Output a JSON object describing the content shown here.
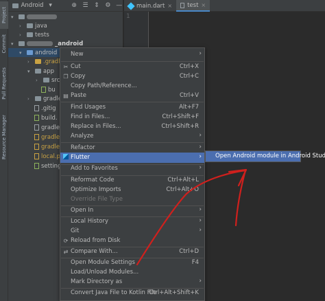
{
  "left_strip": {
    "tabs": [
      "Project",
      "Commit",
      "Pull Requests",
      "Resource Manager"
    ]
  },
  "project_panel": {
    "title": "Android",
    "tree": [
      {
        "label": "java",
        "indent": 2,
        "icon": "folder"
      },
      {
        "label": "tests",
        "indent": 2,
        "icon": "folder"
      },
      {
        "label": "_android",
        "indent": 1,
        "icon": "folder",
        "bold": true
      },
      {
        "label": "android",
        "indent": 2,
        "icon": "folder-blue",
        "selected": true
      },
      {
        "label": ".gradle",
        "indent": 3,
        "icon": "folder-orange"
      },
      {
        "label": "app",
        "indent": 3,
        "icon": "folder"
      },
      {
        "label": "src",
        "indent": 4,
        "icon": "folder"
      },
      {
        "label": "bu",
        "indent": 4,
        "icon": "folder"
      },
      {
        "label": "gradle",
        "indent": 3,
        "icon": "folder"
      },
      {
        "label": ".gitig",
        "indent": 3,
        "icon": "file"
      },
      {
        "label": "build.",
        "indent": 3,
        "icon": "file-green"
      },
      {
        "label": "gradle",
        "indent": 3,
        "icon": "file"
      },
      {
        "label": "gradle",
        "indent": 3,
        "icon": "file-orange"
      },
      {
        "label": "gradle",
        "indent": 3,
        "icon": "file-orange"
      },
      {
        "label": "local.p",
        "indent": 3,
        "icon": "file-orange"
      },
      {
        "label": "setting",
        "indent": 3,
        "icon": "file"
      }
    ]
  },
  "editor": {
    "tabs": [
      {
        "label": "main.dart",
        "active": false
      },
      {
        "label": "test",
        "active": true
      }
    ],
    "line_number": "1"
  },
  "context_menu": {
    "items": [
      {
        "label": "New",
        "shortcut": "",
        "submenu": true
      },
      {
        "sep": true
      },
      {
        "label": "Cut",
        "shortcut": "Ctrl+X",
        "icon": "cut-icon"
      },
      {
        "label": "Copy",
        "shortcut": "Ctrl+C",
        "icon": "copy-icon"
      },
      {
        "label": "Copy Path/Reference...",
        "shortcut": ""
      },
      {
        "label": "Paste",
        "shortcut": "Ctrl+V",
        "icon": "paste-icon"
      },
      {
        "sep": true
      },
      {
        "label": "Find Usages",
        "shortcut": "Alt+F7"
      },
      {
        "label": "Find in Files...",
        "shortcut": "Ctrl+Shift+F"
      },
      {
        "label": "Replace in Files...",
        "shortcut": "Ctrl+Shift+R"
      },
      {
        "label": "Analyze",
        "shortcut": "",
        "submenu": true
      },
      {
        "sep": true
      },
      {
        "label": "Refactor",
        "shortcut": "",
        "submenu": true
      },
      {
        "sep": true
      },
      {
        "label": "Flutter",
        "shortcut": "",
        "submenu": true,
        "highlighted": true,
        "icon": "flutter-icon"
      },
      {
        "sep": true
      },
      {
        "label": "Add to Favorites",
        "shortcut": "",
        "submenu": true
      },
      {
        "sep": true
      },
      {
        "label": "Reformat Code",
        "shortcut": "Ctrl+Alt+L"
      },
      {
        "label": "Optimize Imports",
        "shortcut": "Ctrl+Alt+O"
      },
      {
        "label": "Override File Type",
        "shortcut": "",
        "disabled": true
      },
      {
        "sep": true
      },
      {
        "label": "Open In",
        "shortcut": "",
        "submenu": true
      },
      {
        "sep": true
      },
      {
        "label": "Local History",
        "shortcut": "",
        "submenu": true
      },
      {
        "label": "Git",
        "shortcut": "",
        "submenu": true
      },
      {
        "label": "Reload from Disk",
        "shortcut": "",
        "icon": "reload-icon"
      },
      {
        "sep": true
      },
      {
        "label": "Compare With...",
        "shortcut": "Ctrl+D",
        "icon": "compare-icon"
      },
      {
        "sep": true
      },
      {
        "label": "Open Module Settings",
        "shortcut": "F4"
      },
      {
        "label": "Load/Unload Modules...",
        "shortcut": ""
      },
      {
        "label": "Mark Directory as",
        "shortcut": "",
        "submenu": true
      },
      {
        "sep": true
      },
      {
        "label": "Convert Java File to Kotlin File",
        "shortcut": "Ctrl+Alt+Shift+K"
      }
    ]
  },
  "flutter_submenu": {
    "items": [
      "Open Android module in Android Studio"
    ]
  },
  "colors": {
    "highlight": "#4b6eaf",
    "annotation": "#d0201d"
  }
}
